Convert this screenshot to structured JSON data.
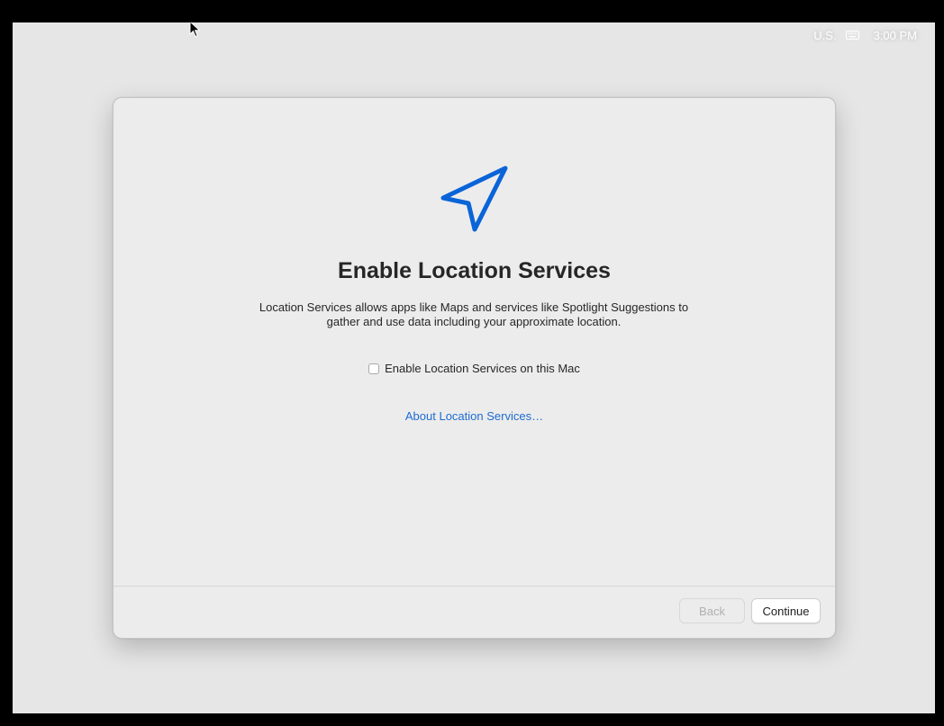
{
  "menubar": {
    "input_source": "U.S.",
    "keyboard_icon": "keyboard-icon",
    "clock": "3:00 PM"
  },
  "setup": {
    "icon": "location-arrow-icon",
    "accent_color": "#0a64d8",
    "title": "Enable Location Services",
    "description": "Location Services allows apps like Maps and services like Spotlight Suggestions to gather and use data including your approximate location.",
    "checkbox_label": "Enable Location Services on this Mac",
    "checkbox_checked": false,
    "about_link": "About Location Services…"
  },
  "footer": {
    "back_label": "Back",
    "back_enabled": false,
    "continue_label": "Continue"
  }
}
